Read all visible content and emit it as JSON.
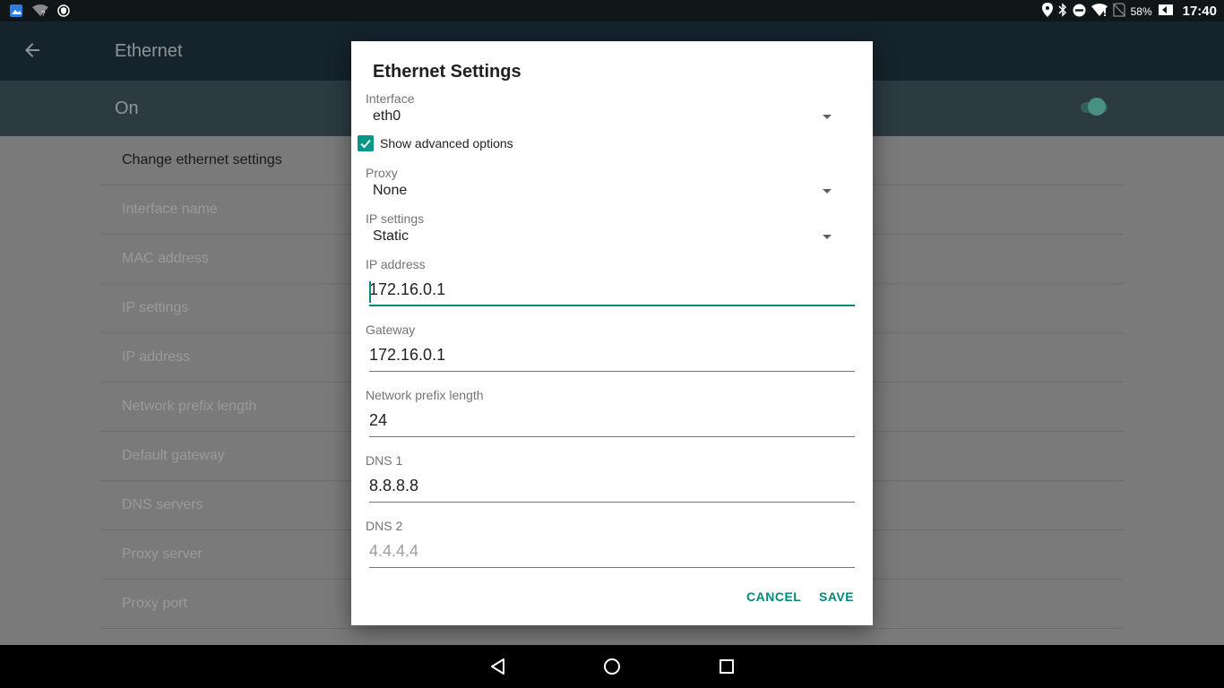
{
  "status_bar": {
    "battery_percent": "58%",
    "time": "17:40",
    "icons_left": [
      "gallery-icon",
      "wifi-unknown-icon",
      "shield-icon"
    ],
    "icons_right": [
      "location-icon",
      "bluetooth-icon",
      "do-not-disturb-icon",
      "wifi-icon",
      "no-sim-icon",
      "battery-icon"
    ]
  },
  "app_bar": {
    "title": "Ethernet"
  },
  "master_switch": {
    "label": "On",
    "state": "on"
  },
  "settings_list": {
    "header": "Change ethernet settings",
    "items": [
      "Interface name",
      "MAC address",
      "IP settings",
      "IP address",
      "Network prefix length",
      "Default gateway",
      "DNS servers",
      "Proxy server",
      "Proxy port"
    ]
  },
  "dialog": {
    "title": "Ethernet Settings",
    "interface": {
      "label": "Interface",
      "value": "eth0"
    },
    "advanced": {
      "label": "Show advanced options",
      "checked": true
    },
    "proxy": {
      "label": "Proxy",
      "value": "None"
    },
    "ip_settings": {
      "label": "IP settings",
      "value": "Static"
    },
    "ip_address": {
      "label": "IP address",
      "value": "172.16.0.1"
    },
    "gateway": {
      "label": "Gateway",
      "value": "172.16.0.1"
    },
    "prefix_length": {
      "label": "Network prefix length",
      "value": "24"
    },
    "dns1": {
      "label": "DNS 1",
      "value": "8.8.8.8"
    },
    "dns2": {
      "label": "DNS 2",
      "placeholder": "4.4.4.4"
    },
    "cancel_label": "CANCEL",
    "save_label": "SAVE"
  },
  "colors": {
    "accent": "#009688",
    "button_text": "#00897b",
    "scrim": "#7a7a7a"
  }
}
